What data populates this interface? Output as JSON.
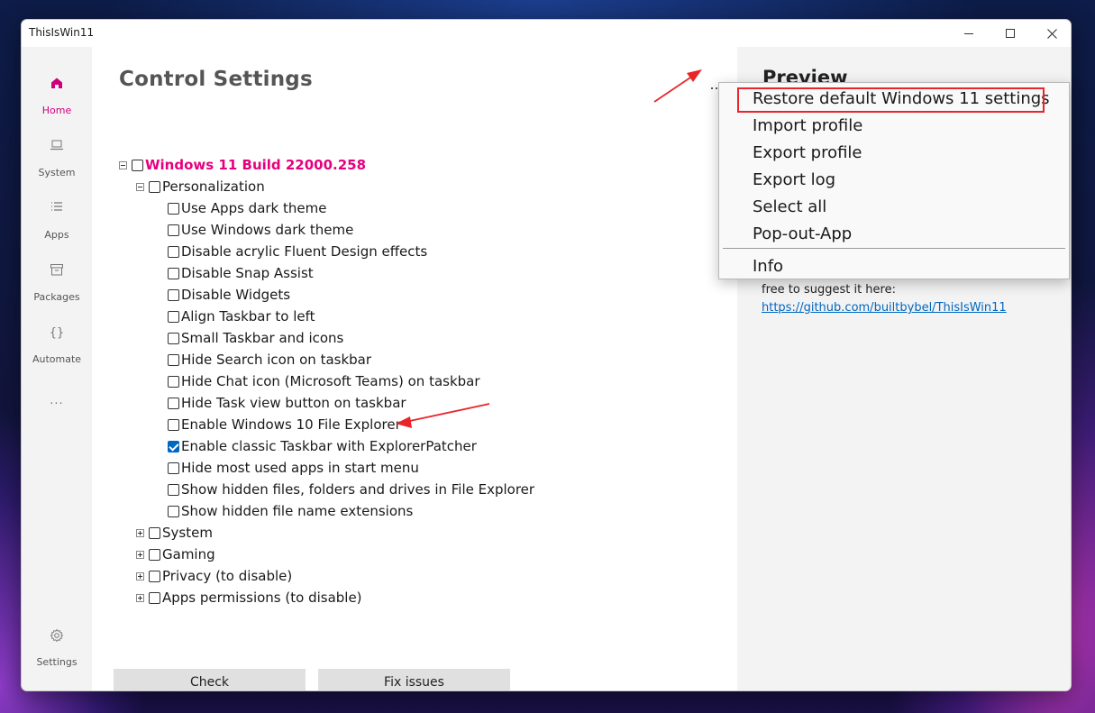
{
  "window": {
    "title": "ThisIsWin11"
  },
  "sidebar": {
    "items": [
      {
        "label": "Home",
        "icon": "home-icon"
      },
      {
        "label": "System",
        "icon": "laptop-icon"
      },
      {
        "label": "Apps",
        "icon": "list-icon"
      },
      {
        "label": "Packages",
        "icon": "package-icon"
      },
      {
        "label": "Automate",
        "icon": "braces-icon"
      },
      {
        "label": "Settings",
        "icon": "gear-icon"
      }
    ],
    "more_glyph": "···",
    "braces_glyph": "{}"
  },
  "page": {
    "title": "Control Settings"
  },
  "tree": {
    "root": "Windows 11 Build 22000.258",
    "personalization": "Personalization",
    "items": [
      {
        "label": "Use Apps dark theme",
        "checked": false
      },
      {
        "label": "Use Windows dark theme",
        "checked": false
      },
      {
        "label": "Disable acrylic Fluent Design effects",
        "checked": false
      },
      {
        "label": "Disable Snap Assist",
        "checked": false
      },
      {
        "label": "Disable Widgets",
        "checked": false
      },
      {
        "label": "Align Taskbar to left",
        "checked": false
      },
      {
        "label": "Small Taskbar and icons",
        "checked": false
      },
      {
        "label": "Hide Search icon on taskbar",
        "checked": false
      },
      {
        "label": "Hide Chat icon (Microsoft Teams) on taskbar",
        "checked": false
      },
      {
        "label": "Hide Task view button on taskbar",
        "checked": false
      },
      {
        "label": "Enable Windows 10 File Explorer",
        "checked": false
      },
      {
        "label": "Enable classic Taskbar with ExplorerPatcher",
        "checked": true
      },
      {
        "label": "Hide most used apps in start menu",
        "checked": false
      },
      {
        "label": "Show hidden files, folders and drives in File Explorer",
        "checked": false
      },
      {
        "label": "Show hidden file name extensions",
        "checked": false
      }
    ],
    "groups": [
      {
        "label": "System"
      },
      {
        "label": "Gaming"
      },
      {
        "label": "Privacy (to disable)"
      },
      {
        "label": "Apps permissions (to disable)"
      }
    ]
  },
  "buttons": {
    "check": "Check",
    "fix": "Fix issues"
  },
  "preview": {
    "heading": "Preview",
    "text": "free to suggest it here:",
    "link": "https://github.com/builtbybel/ThisIsWin11"
  },
  "menu": {
    "items": [
      "Restore default Windows 11 settings",
      "Import profile",
      "Export profile",
      "Export log",
      "Select all",
      "Pop-out-App"
    ],
    "info": "Info"
  },
  "colors": {
    "accent": "#e6007e",
    "checkbox_checked": "#0067c0",
    "annotation": "#e8262a"
  }
}
